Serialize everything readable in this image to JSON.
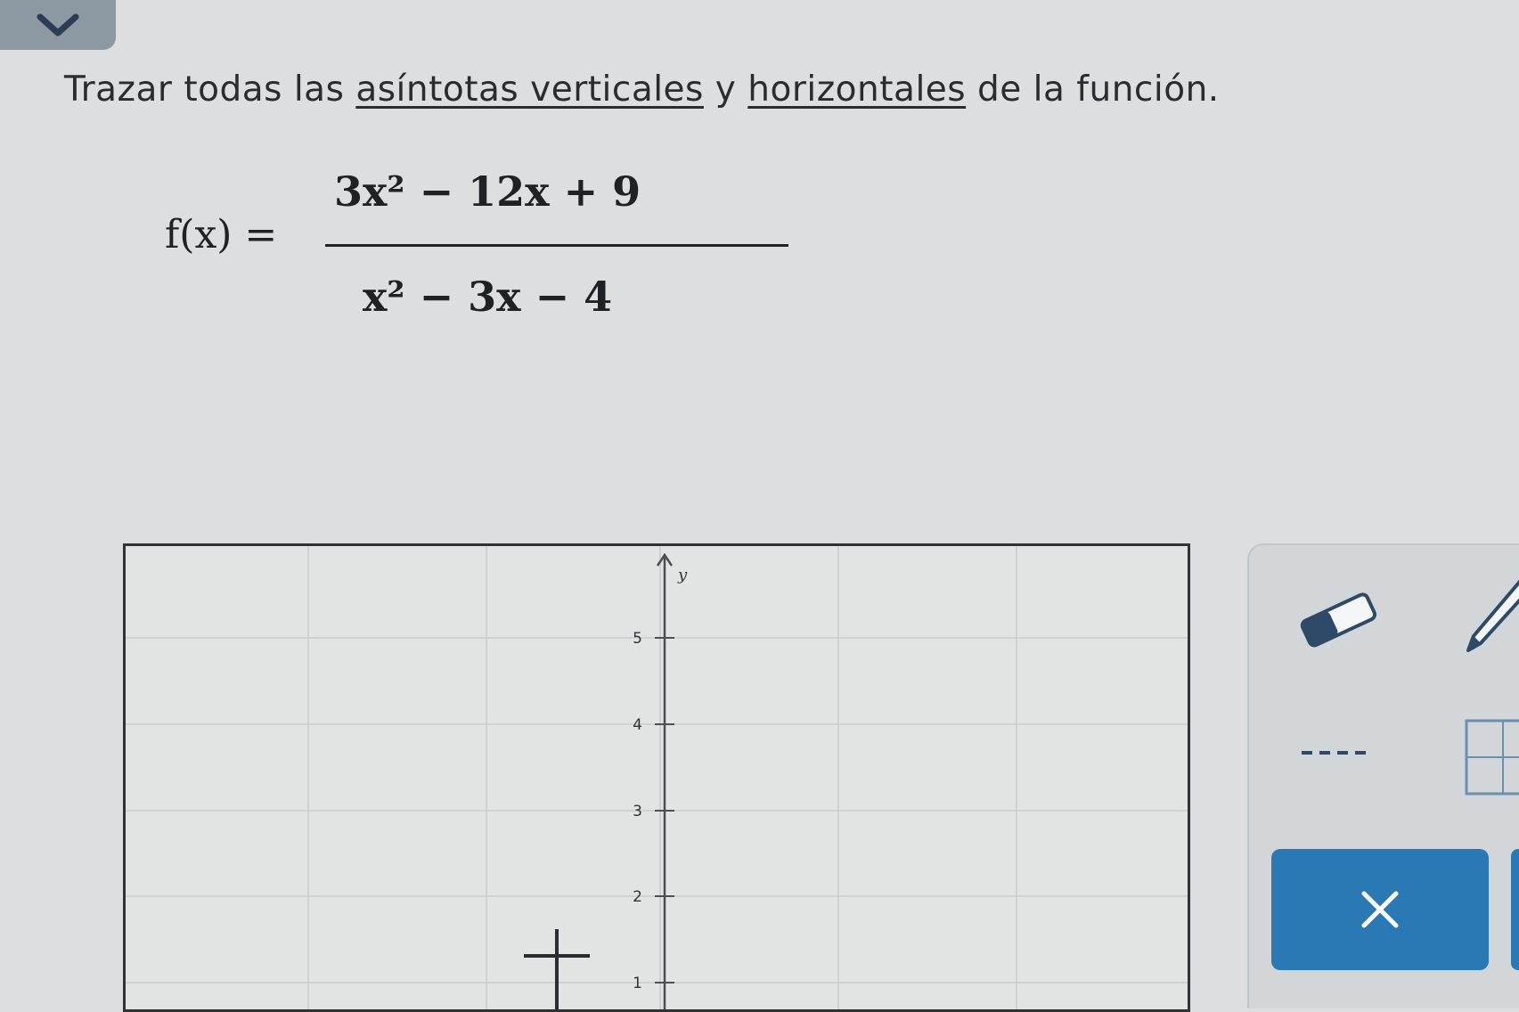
{
  "header": {
    "collapse_icon": "chevron-down-icon"
  },
  "question": {
    "instruction_start": "Trazar todas las ",
    "term_vertical": "asíntotas verticales",
    "connector": " y ",
    "term_horizontal": "horizontales",
    "instruction_end": " de la función."
  },
  "formula": {
    "lhs": "f(x) =",
    "numerator": "3x² − 12x + 9",
    "denominator": "x² − 3x − 4"
  },
  "graph": {
    "y_axis_label": "y",
    "y_ticks": [
      "5",
      "4",
      "3",
      "2",
      "1"
    ],
    "cursor_icon": "crosshair-plus-icon"
  },
  "tools": {
    "eraser_icon": "eraser-icon",
    "pencil_icon": "pencil-icon",
    "dashed_line_icon": "dashed-line-icon",
    "asymptote_grid_icon": "graph-grid-icon",
    "clear_icon": "close-icon",
    "accent_color": "#2a79b4"
  }
}
